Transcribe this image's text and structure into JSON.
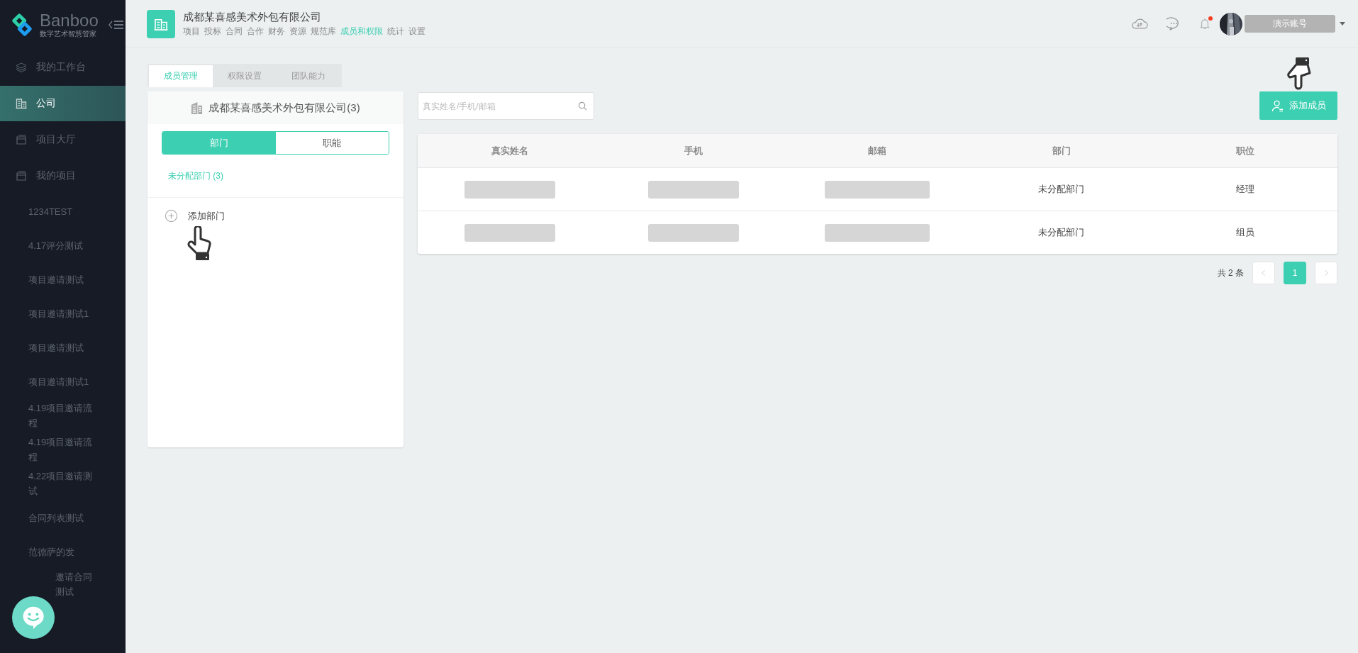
{
  "sidebar": {
    "logo": {
      "name": "Banboo",
      "tagline": "数字艺术智慧管家"
    },
    "items": [
      {
        "kind": "main",
        "lines": [
          "我的工作台"
        ],
        "selected": false
      },
      {
        "kind": "main",
        "lines": [
          "公司"
        ],
        "selected": true
      },
      {
        "kind": "main",
        "lines": [
          "项目大厅"
        ],
        "selected": false
      },
      {
        "kind": "main",
        "lines": [
          "我的项目"
        ],
        "selected": false
      },
      {
        "kind": "project",
        "lines": [
          "1234TEST"
        ],
        "selected": false
      },
      {
        "kind": "project",
        "lines": [
          "4.17评分测试"
        ],
        "selected": false
      },
      {
        "kind": "project",
        "lines": [
          "项目邀请测试"
        ],
        "selected": false
      },
      {
        "kind": "project",
        "lines": [
          "项目邀请测试1"
        ],
        "selected": false
      },
      {
        "kind": "project",
        "lines": [
          "项目邀请测试"
        ],
        "selected": false
      },
      {
        "kind": "project",
        "lines": [
          "项目邀请测试1"
        ],
        "selected": false
      },
      {
        "kind": "project",
        "lines": [
          "4.19项目邀请流",
          "程"
        ],
        "selected": false
      },
      {
        "kind": "project",
        "lines": [
          "4.19项目邀请流",
          "程"
        ],
        "selected": false
      },
      {
        "kind": "project",
        "lines": [
          "4.22项目邀请测",
          "试"
        ],
        "selected": false
      },
      {
        "kind": "project",
        "lines": [
          "合同列表测试"
        ],
        "selected": false
      },
      {
        "kind": "project",
        "lines": [
          "范德萨的发"
        ],
        "selected": false
      },
      {
        "kind": "covered",
        "lines": [
          "邀请合同",
          "测试"
        ],
        "selected": false
      }
    ]
  },
  "header": {
    "company": "成都某喜感美术外包有限公司",
    "nav": [
      {
        "label": "项目",
        "selected": false
      },
      {
        "label": "投标",
        "selected": false
      },
      {
        "label": "合同",
        "selected": false
      },
      {
        "label": "合作",
        "selected": false
      },
      {
        "label": "财务",
        "selected": false
      },
      {
        "label": "资源",
        "selected": false
      },
      {
        "label": "规范库",
        "selected": false
      },
      {
        "label": "成员和权限",
        "selected": true
      },
      {
        "label": "统计",
        "selected": false
      },
      {
        "label": "设置",
        "selected": false
      }
    ],
    "notification_dot": true,
    "user": "演示账号"
  },
  "tabs": [
    {
      "label": "成员管理",
      "selected": true
    },
    {
      "label": "权限设置",
      "selected": false
    },
    {
      "label": "团队能力",
      "selected": false
    }
  ],
  "org_panel": {
    "title": "成都某喜感美术外包有限公司(3)",
    "toggle": [
      {
        "label": "部门",
        "selected": true
      },
      {
        "label": "职能",
        "selected": false
      }
    ],
    "departments": [
      {
        "label": "未分配部门 (3)",
        "selected": true
      }
    ],
    "add_department": "添加部门"
  },
  "search": {
    "placeholder": "真实姓名/手机/邮箱"
  },
  "add_member": "添加成员",
  "table": {
    "columns": [
      "真实姓名",
      "手机",
      "邮箱",
      "部门",
      "职位"
    ],
    "rows": [
      {
        "department": "未分配部门",
        "position": "经理"
      },
      {
        "department": "未分配部门",
        "position": "组员"
      }
    ]
  },
  "pagination": {
    "total": "共 2 条",
    "pages": [
      {
        "label": "1",
        "selected": true
      }
    ]
  }
}
